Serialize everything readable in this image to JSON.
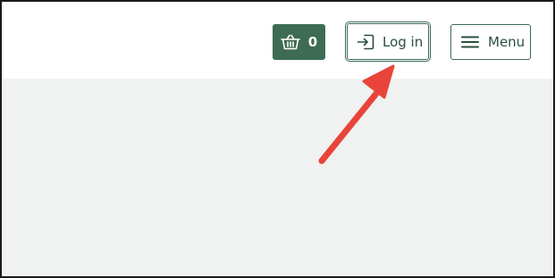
{
  "header": {
    "basket": {
      "count": "0",
      "icon": "basket-icon"
    },
    "login": {
      "label": "Log in",
      "icon": "login-icon"
    },
    "menu": {
      "label": "Menu",
      "icon": "hamburger-icon"
    }
  },
  "colors": {
    "brand_green": "#3d6b54",
    "text_green": "#2b4f3d",
    "content_bg": "#f0f1f1",
    "annotation_red": "#e8443a"
  }
}
